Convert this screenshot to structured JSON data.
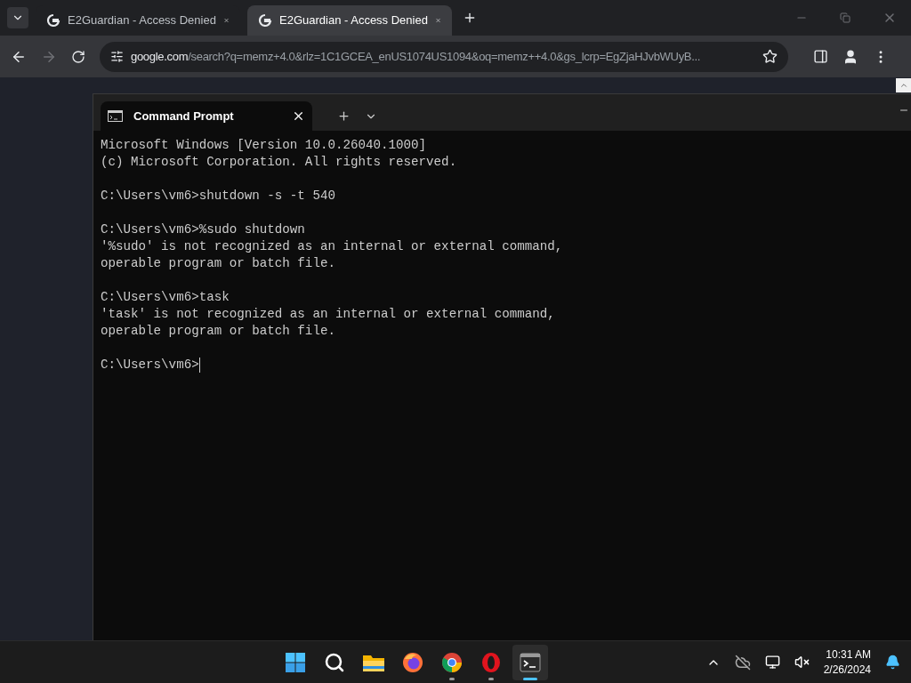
{
  "browser": {
    "tabs": [
      {
        "title": "E2Guardian - Access Denied",
        "selected": false
      },
      {
        "title": "E2Guardian - Access Denied",
        "selected": true
      }
    ],
    "address": {
      "domain": "google.com",
      "path": "/search?q=memz+4.0&rlz=1C1GCEA_enUS1074US1094&oq=memz++4.0&gs_lcrp=EgZjaHJvbWUyB..."
    },
    "forward_disabled": true
  },
  "terminal": {
    "tab": {
      "title": "Command Prompt"
    },
    "blocks": [
      [
        "Microsoft Windows [Version 10.0.26040.1000]",
        "(c) Microsoft Corporation. All rights reserved."
      ],
      [
        "C:\\Users\\vm6>shutdown -s -t 540"
      ],
      [
        "C:\\Users\\vm6>%sudo shutdown",
        "'%sudo' is not recognized as an internal or external command,",
        "operable program or batch file."
      ],
      [
        "C:\\Users\\vm6>task",
        "'task' is not recognized as an internal or external command,",
        "operable program or batch file."
      ],
      [
        "C:\\Users\\vm6>"
      ]
    ],
    "cursor": true
  },
  "taskbar": {
    "apps": [
      {
        "kind": "start",
        "running": false,
        "active": false
      },
      {
        "kind": "search",
        "running": false,
        "active": false
      },
      {
        "kind": "folder",
        "running": false,
        "active": false
      },
      {
        "kind": "firefox",
        "running": false,
        "active": false
      },
      {
        "kind": "chrome",
        "running": true,
        "active": false
      },
      {
        "kind": "opera",
        "running": true,
        "active": false
      },
      {
        "kind": "terminal",
        "running": true,
        "active": true
      }
    ],
    "time": "10:31 AM",
    "date": "2/26/2024"
  }
}
